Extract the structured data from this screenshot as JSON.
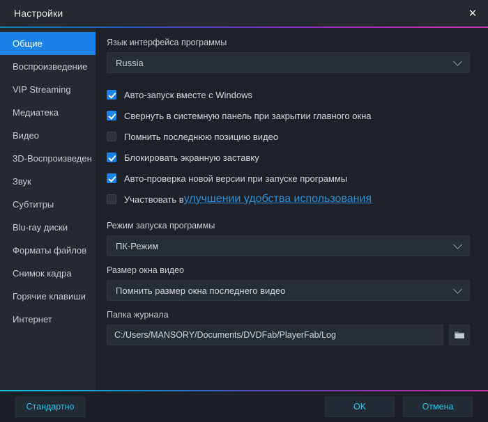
{
  "window": {
    "title": "Настройки",
    "close_icon": "close-icon",
    "accent_blue": "#1b82e8",
    "accent_cyan": "#2ec6e6",
    "link_color": "#2f8fd8"
  },
  "sidebar": {
    "items": [
      {
        "label": "Общие",
        "active": true
      },
      {
        "label": "Воспроизведение",
        "active": false
      },
      {
        "label": "VIP Streaming",
        "active": false
      },
      {
        "label": "Медиатека",
        "active": false
      },
      {
        "label": "Видео",
        "active": false
      },
      {
        "label": "3D-Воспроизведен",
        "active": false
      },
      {
        "label": "Звук",
        "active": false
      },
      {
        "label": "Субтитры",
        "active": false
      },
      {
        "label": "Blu-ray диски",
        "active": false
      },
      {
        "label": "Форматы файлов",
        "active": false
      },
      {
        "label": "Снимок кадра",
        "active": false
      },
      {
        "label": "Горячие клавиши",
        "active": false
      },
      {
        "label": "Интернет",
        "active": false
      }
    ]
  },
  "content": {
    "language": {
      "label": "Язык интерфейса программы",
      "value": "Russia",
      "chevron_icon": "chevron-down-icon"
    },
    "checkboxes": [
      {
        "label": "Авто-запуск вместе с Windows",
        "checked": true
      },
      {
        "label": "Свернуть в системную панель при закрытии главного окна",
        "checked": true
      },
      {
        "label": "Помнить последнюю позицию видео",
        "checked": false
      },
      {
        "label": "Блокировать экранную заставку",
        "checked": true
      },
      {
        "label": "Авто-проверка новой версии при запуске программы",
        "checked": true
      }
    ],
    "improve_row": {
      "checked": false,
      "prefix": "Участвовать в ",
      "link_text": "улучшении удобства использования"
    },
    "launch_mode": {
      "label": "Режим запуска программы",
      "value": "ПК-Режим",
      "chevron_icon": "chevron-down-icon"
    },
    "window_size": {
      "label": "Размер окна видео",
      "value": "Помнить размер окна последнего видео",
      "chevron_icon": "chevron-down-icon"
    },
    "log_folder": {
      "label": "Папка журнала",
      "value": "C:/Users/MANSORY/Documents/DVDFab/PlayerFab/Log",
      "browse_icon": "folder-icon"
    }
  },
  "footer": {
    "default_label": "Стандартно",
    "ok_label": "OK",
    "cancel_label": "Отмена"
  }
}
